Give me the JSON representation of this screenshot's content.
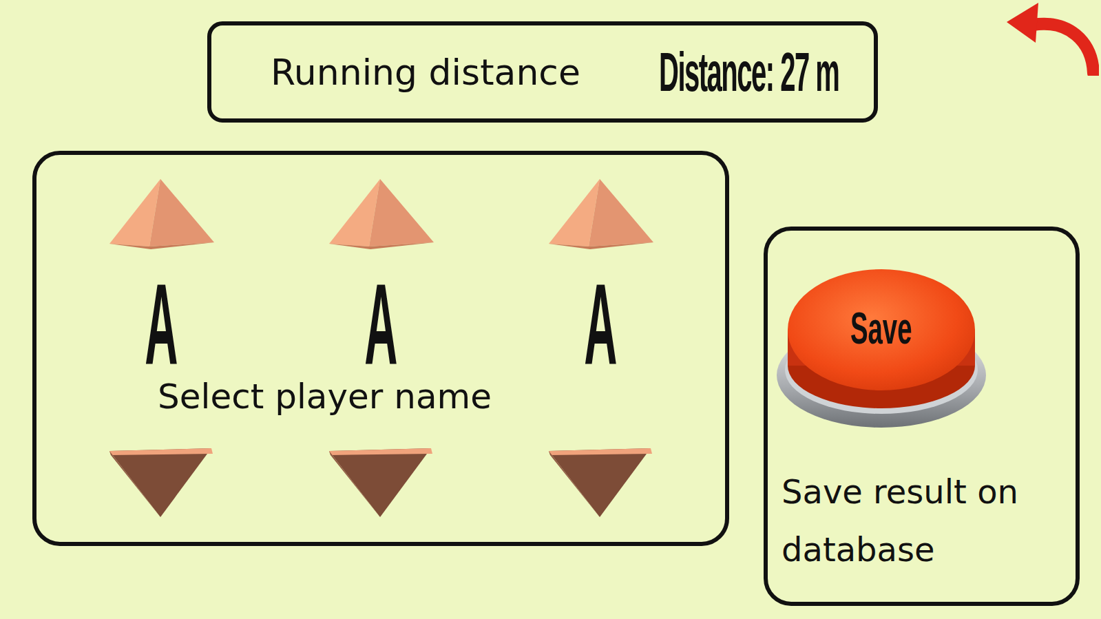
{
  "header": {
    "title": "Running distance",
    "distance": "Distance: 27 m"
  },
  "name_picker": {
    "letters": [
      {
        "value": "A"
      },
      {
        "value": "A"
      },
      {
        "value": "A"
      }
    ],
    "label": "Select player name"
  },
  "save": {
    "button": "Save",
    "label": "Save result on database"
  }
}
